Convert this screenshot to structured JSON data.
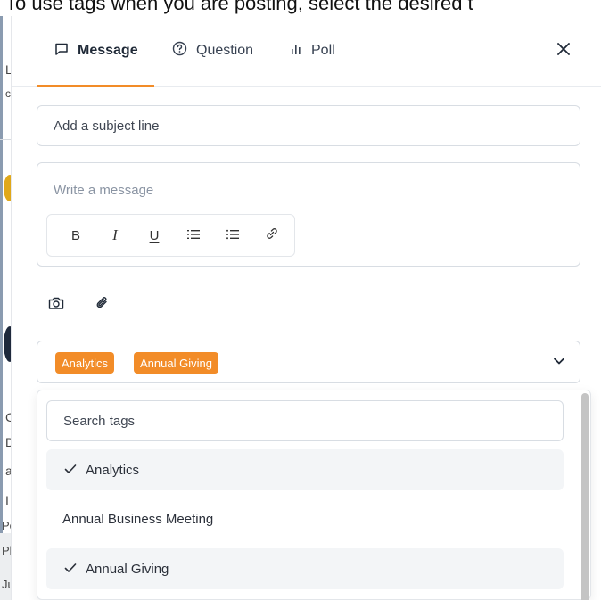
{
  "background": {
    "instruction_text": "To use tags when you are posting, select the desired t",
    "left_letters": [
      "L",
      "c",
      "C",
      "D",
      "a",
      "I",
      "Pos",
      "Plea",
      "Just"
    ]
  },
  "tabs": [
    {
      "label": "Message",
      "icon": "message-square-icon",
      "active": true
    },
    {
      "label": "Question",
      "icon": "question-circle-icon",
      "active": false
    },
    {
      "label": "Poll",
      "icon": "bar-chart-icon",
      "active": false
    }
  ],
  "subject": {
    "placeholder": "Add a subject line",
    "value": ""
  },
  "editor": {
    "placeholder": "Write a message"
  },
  "toolbar": {
    "buttons": [
      {
        "label": "B",
        "name": "bold"
      },
      {
        "label": "I",
        "name": "italic"
      },
      {
        "label": "U",
        "name": "underline"
      },
      {
        "label": "",
        "name": "ordered-list"
      },
      {
        "label": "",
        "name": "bullet-list"
      },
      {
        "label": "",
        "name": "link"
      }
    ]
  },
  "attachments": [
    "camera-icon",
    "paperclip-icon"
  ],
  "tags": {
    "selected": [
      "Analytics",
      "Annual Giving"
    ],
    "search_placeholder": "Search tags",
    "options": [
      {
        "label": "Analytics",
        "selected": true
      },
      {
        "label": "Annual Business Meeting",
        "selected": false
      },
      {
        "label": "Annual Giving",
        "selected": true
      }
    ]
  },
  "colors": {
    "accent": "#f28c28",
    "chip_text": "#ffffff",
    "selected_row": "#f3f5f7"
  }
}
